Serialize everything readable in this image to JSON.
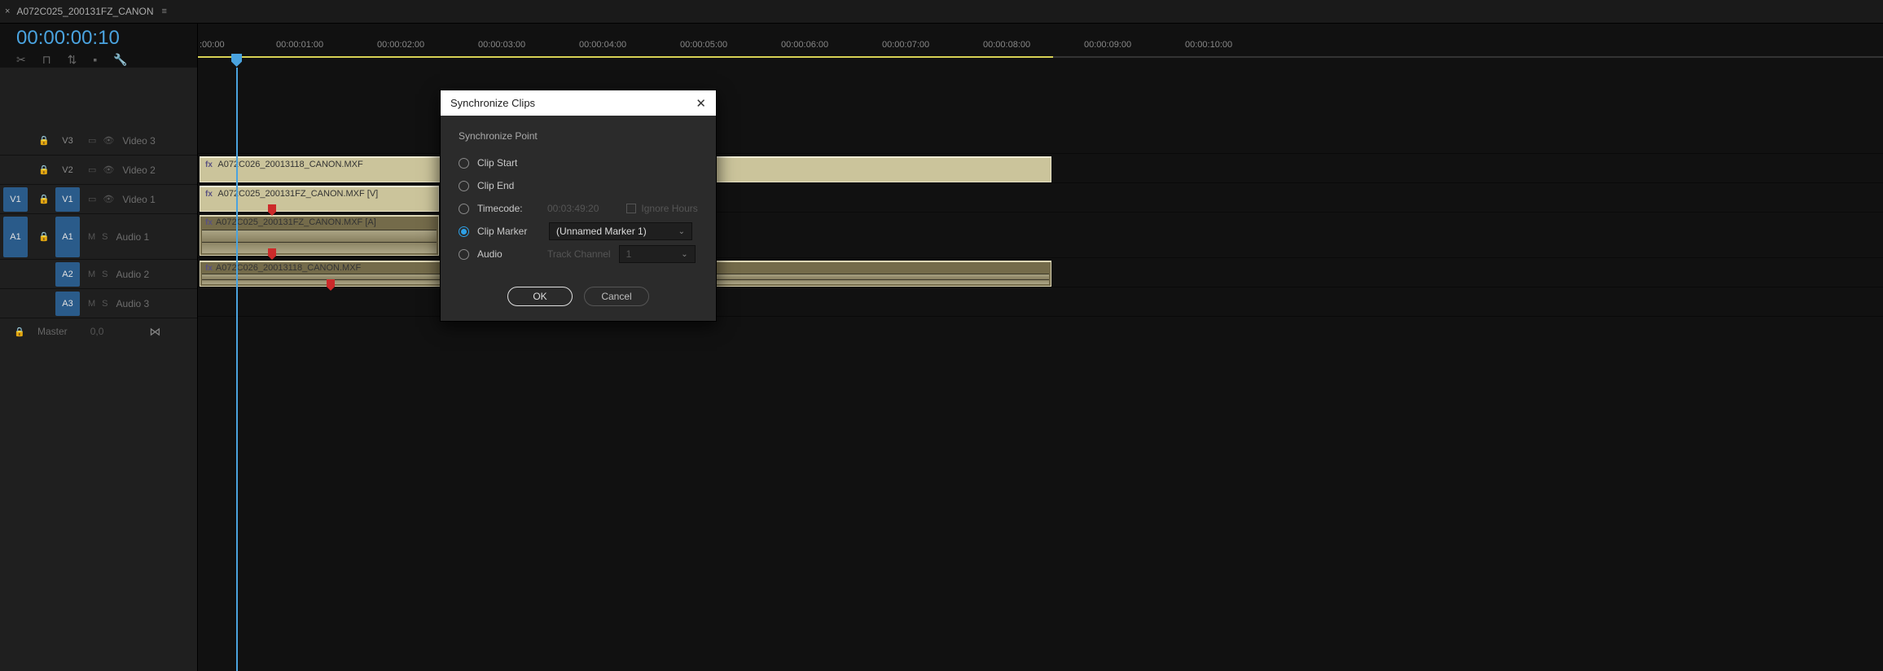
{
  "tab": {
    "close": "×",
    "name": "A072C025_200131FZ_CANON",
    "menu": "≡"
  },
  "playhead_tc": "00:00:00:10",
  "ruler": {
    "ticks": [
      ":00:00",
      "00:00:01:00",
      "00:00:02:00",
      "00:00:03:00",
      "00:00:04:00",
      "00:00:05:00",
      "00:00:06:00",
      "00:00:07:00",
      "00:00:08:00",
      "00:00:09:00",
      "00:00:10:00"
    ]
  },
  "tracks": {
    "v3": {
      "src": "",
      "tgt": "V3",
      "name": "Video 3"
    },
    "v2": {
      "src": "",
      "tgt": "V2",
      "name": "Video 2"
    },
    "v1": {
      "src": "V1",
      "tgt": "V1",
      "name": "Video 1"
    },
    "a1": {
      "src": "A1",
      "tgt": "A1",
      "name": "Audio 1",
      "m": "M",
      "s": "S"
    },
    "a2": {
      "src": "",
      "tgt": "A2",
      "name": "Audio 2",
      "m": "M",
      "s": "S"
    },
    "a3": {
      "src": "",
      "tgt": "A3",
      "name": "Audio 3",
      "m": "M",
      "s": "S"
    },
    "master": {
      "label": "Master",
      "val": "0,0"
    }
  },
  "clips": {
    "v2": {
      "fx": "fx",
      "name": "A072C026_20013118_CANON.MXF"
    },
    "v1": {
      "fx": "fx",
      "name": "A072C025_200131FZ_CANON.MXF [V]"
    },
    "a1": {
      "fx": "fx",
      "name": "A072C025_200131FZ_CANON.MXF [A]"
    },
    "a2": {
      "fx": "fx",
      "name": "A072C026_20013118_CANON.MXF"
    }
  },
  "dialog": {
    "title": "Synchronize Clips",
    "group": "Synchronize Point",
    "opt_start": "Clip Start",
    "opt_end": "Clip End",
    "opt_tc": "Timecode:",
    "tc_value": "00:03:49:20",
    "ignore": "Ignore Hours",
    "opt_marker": "Clip Marker",
    "marker_sel": "(Unnamed Marker 1)",
    "opt_audio": "Audio",
    "track_channel": "Track Channel",
    "channel_val": "1",
    "ok": "OK",
    "cancel": "Cancel"
  }
}
